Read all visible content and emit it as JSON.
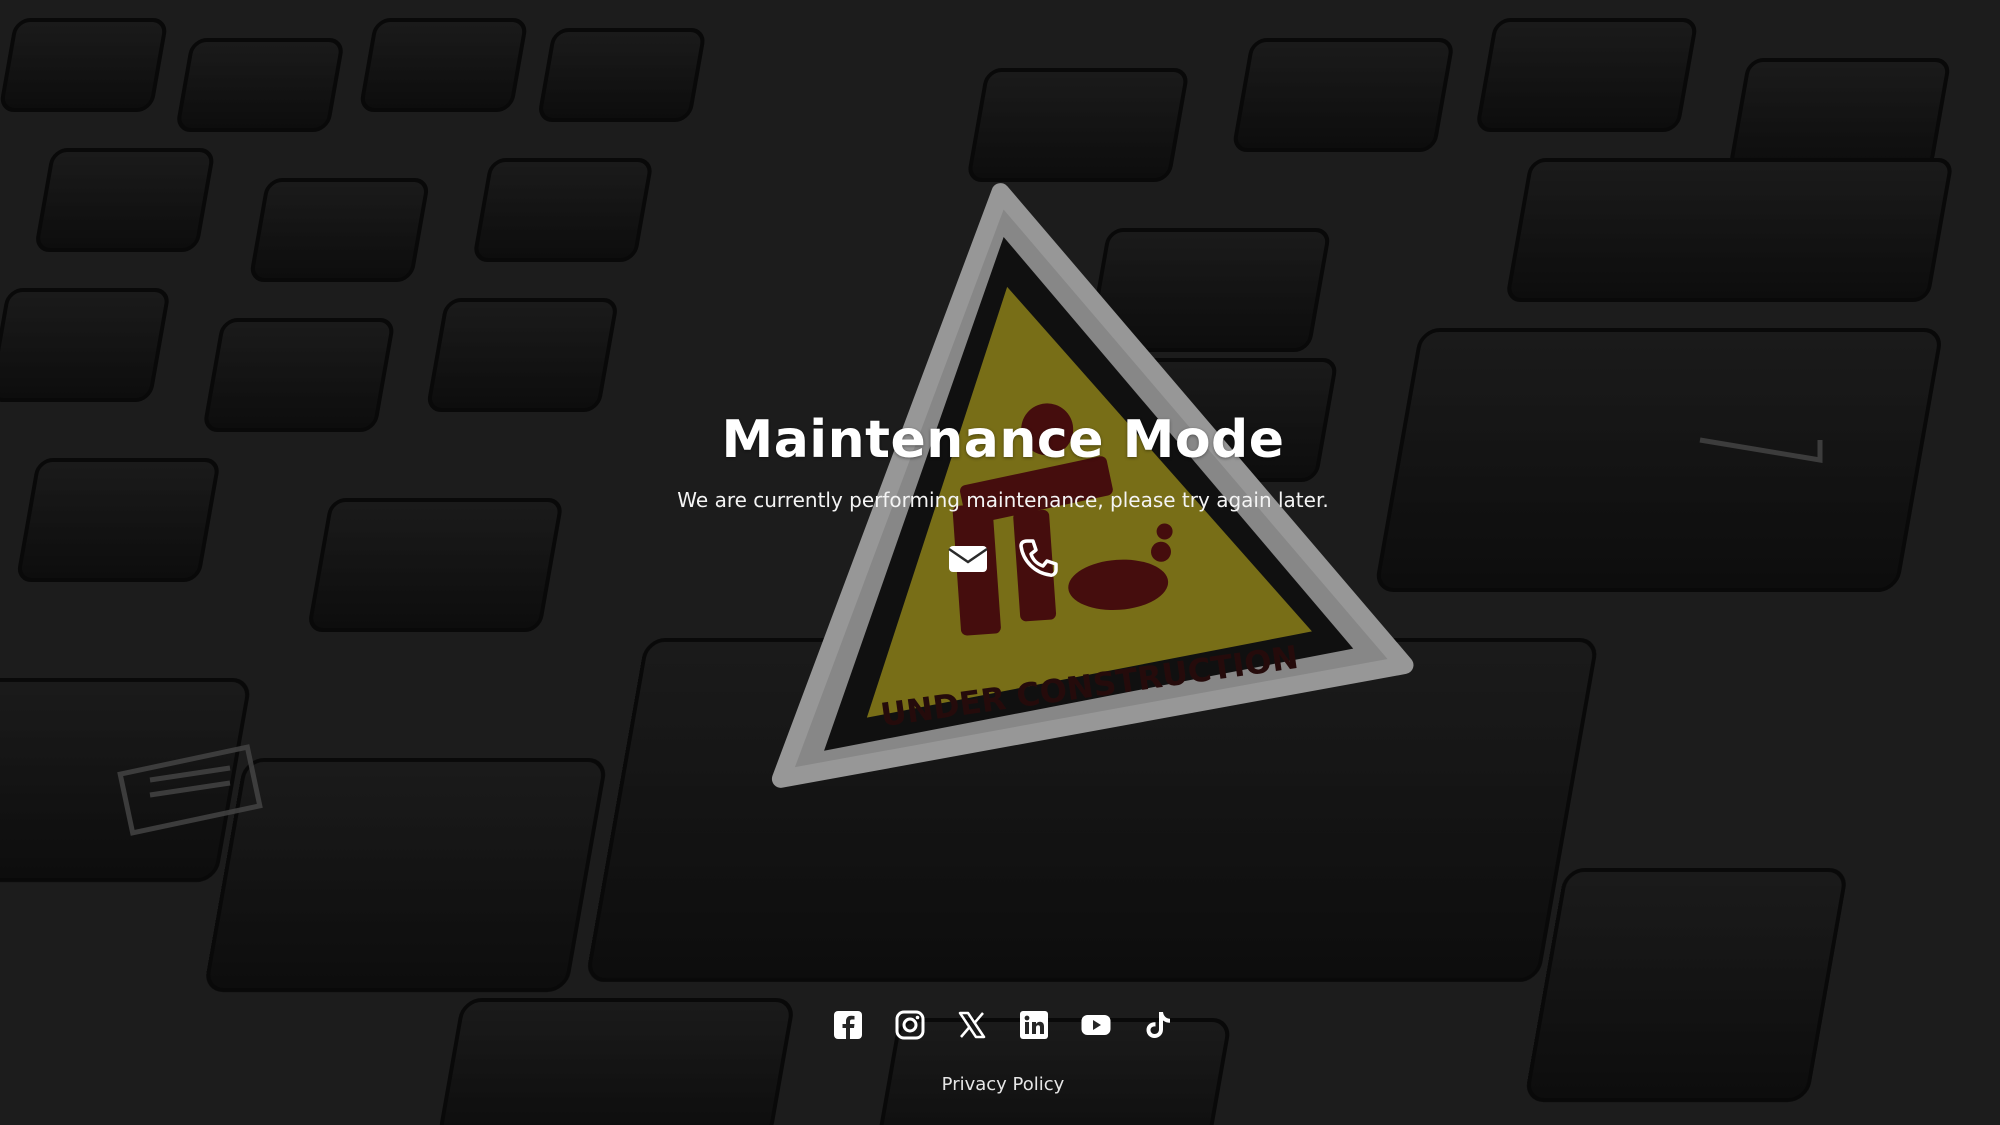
{
  "page": {
    "title": "Maintenance Mode",
    "message": "We are currently performing maintenance, please try again later.",
    "background_sign_text": "UNDER CONSTRUCTION"
  },
  "contact": {
    "icons": [
      "envelope-icon",
      "phone-icon"
    ]
  },
  "social": {
    "icons": [
      "facebook-icon",
      "instagram-icon",
      "x-icon",
      "linkedin-icon",
      "youtube-icon",
      "tiktok-icon"
    ]
  },
  "footer": {
    "privacy_label": "Privacy Policy"
  },
  "colors": {
    "text": "#ffffff",
    "sign_yellow": "#d7c62a",
    "sign_red": "#7a1212",
    "key_dark": "#1c1c1c"
  }
}
